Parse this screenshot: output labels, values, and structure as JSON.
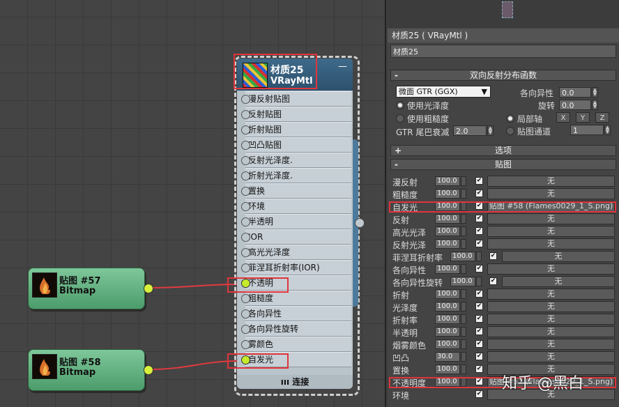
{
  "node_editor": {
    "bitmap_nodes": [
      {
        "title": "贴图 #57",
        "type": "Bitmap"
      },
      {
        "title": "贴图 #58",
        "type": "Bitmap"
      }
    ],
    "material_node": {
      "title": "材质25",
      "type": "VRayMtl",
      "minimize": "—",
      "slots": [
        "漫反射贴图",
        "反射贴图",
        "折射贴图",
        "凹凸贴图",
        "反射光泽度.",
        "折射光泽度.",
        "置换",
        "环境",
        "半透明",
        "IOR",
        "高光光泽度",
        "菲涅耳折射率(IOR)",
        "不透明",
        "粗糙度",
        "各向异性",
        "各向异性旋转",
        "雾颜色",
        "自发光"
      ],
      "footer": "连接"
    }
  },
  "panel": {
    "title": "材质25 ( VRayMtl )",
    "name_value": "材质25",
    "brdf_rollout": {
      "sign": "-",
      "title": "双向反射分布函数",
      "type_dropdown": "微面 GTR (GGX)",
      "anisotropy_label": "各向异性",
      "anisotropy_value": "0.0",
      "rotation_label": "旋转",
      "rotation_value": "0.0",
      "use_glossiness": "使用光泽度",
      "use_roughness": "使用粗糙度",
      "local_axis": "局部轴",
      "axes": [
        "X",
        "Y",
        "Z"
      ],
      "gtr_tail_label": "GTR 尾巴衰减",
      "gtr_tail_value": "2.0",
      "map_channel": "贴图通道",
      "map_channel_value": "1"
    },
    "options_rollout": {
      "sign": "+",
      "title": "选项"
    },
    "maps_rollout": {
      "sign": "-",
      "title": "贴图",
      "rows": [
        {
          "label": "漫反射",
          "value": "100.0",
          "map": "无"
        },
        {
          "label": "粗糙度",
          "value": "100.0",
          "map": "无"
        },
        {
          "label": "自发光",
          "value": "100.0",
          "map": "贴图 #58 (Flames0029_1_S.png)"
        },
        {
          "label": "反射",
          "value": "100.0",
          "map": "无"
        },
        {
          "label": "高光光泽",
          "value": "100.0",
          "map": "无"
        },
        {
          "label": "反射光泽",
          "value": "100.0",
          "map": "无"
        },
        {
          "label": "菲涅耳折射率",
          "value": "100.0",
          "map": "无"
        },
        {
          "label": "各向异性",
          "value": "100.0",
          "map": "无"
        },
        {
          "label": "各向异性旋转",
          "value": "100.0",
          "map": "无"
        },
        {
          "label": "折射",
          "value": "100.0",
          "map": "无"
        },
        {
          "label": "光泽度",
          "value": "100.0",
          "map": "无"
        },
        {
          "label": "折射率",
          "value": "100.0",
          "map": "无"
        },
        {
          "label": "半透明",
          "value": "100.0",
          "map": "无"
        },
        {
          "label": "烟雾颜色",
          "value": "100.0",
          "map": "无"
        },
        {
          "label": "凹凸",
          "value": "30.0",
          "map": "无"
        },
        {
          "label": "置换",
          "value": "100.0",
          "map": "无"
        },
        {
          "label": "不透明度",
          "value": "100.0",
          "map": "贴图 #57 (Flames0029_1_S.png)"
        },
        {
          "label": "环境",
          "value": "",
          "map": "无"
        }
      ]
    }
  },
  "watermark": "知乎 @黑白",
  "colors": {
    "highlight": "#e0353b",
    "socket_active": "#c6ea2c",
    "node_header": "#2d516d",
    "bitmap_node": "#5aa87a"
  }
}
